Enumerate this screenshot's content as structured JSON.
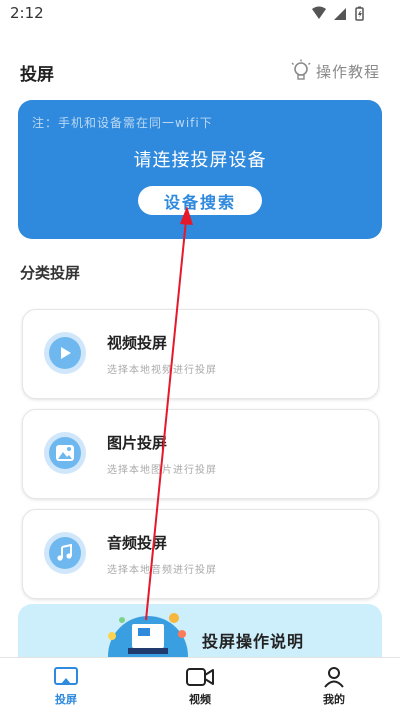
{
  "status_bar": {
    "time": "2:12"
  },
  "header": {
    "title": "投屏",
    "tutorial_label": "操作教程"
  },
  "hero": {
    "note": "注：手机和设备需在同一wifi下",
    "title": "请连接投屏设备",
    "button_label": "设备搜索"
  },
  "category": {
    "title": "分类投屏",
    "cards": [
      {
        "title": "视频投屏",
        "subtitle": "选择本地视频进行投屏",
        "icon": "play-icon"
      },
      {
        "title": "图片投屏",
        "subtitle": "选择本地图片进行投屏",
        "icon": "image-icon"
      },
      {
        "title": "音频投屏",
        "subtitle": "选择本地音频进行投屏",
        "icon": "music-icon"
      }
    ]
  },
  "guide": {
    "label": "投屏操作说明"
  },
  "bottom_nav": {
    "items": [
      {
        "label": "投屏",
        "icon": "cast-icon",
        "active": true
      },
      {
        "label": "视频",
        "icon": "video-camera-icon",
        "active": false
      },
      {
        "label": "我的",
        "icon": "person-icon",
        "active": false
      }
    ]
  },
  "colors": {
    "accent": "#2f89dd",
    "nav_active": "#2f89dd",
    "annotation_arrow": "#e5192b"
  }
}
